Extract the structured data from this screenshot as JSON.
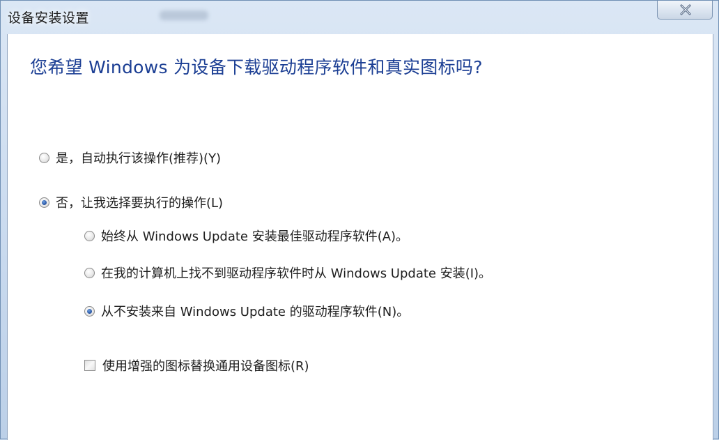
{
  "window": {
    "title": "设备安装设置",
    "close_label": "close"
  },
  "dialog": {
    "question": "您希望 Windows 为设备下载驱动程序软件和真实图标吗?",
    "options": [
      {
        "label": "是，自动执行该操作(推荐)(Y)",
        "checked": false
      },
      {
        "label": "否，让我选择要执行的操作(L)",
        "checked": true
      }
    ],
    "sub_options": [
      {
        "label": "始终从 Windows Update 安装最佳驱动程序软件(A)。",
        "checked": false
      },
      {
        "label": "在我的计算机上找不到驱动程序软件时从 Windows Update 安装(I)。",
        "checked": false
      },
      {
        "label": "从不安装来自 Windows Update 的驱动程序软件(N)。",
        "checked": true
      }
    ],
    "checkbox": {
      "label": "使用增强的图标替换通用设备图标(R)",
      "checked": false
    }
  },
  "icons": {
    "close": "close-icon"
  }
}
